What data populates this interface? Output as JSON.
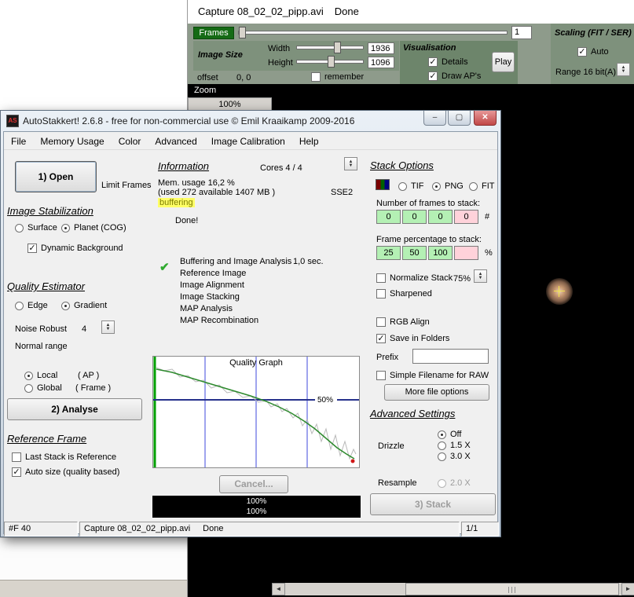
{
  "colors": {
    "frames_badge": "#156b15",
    "highlight_yellow": "#ffff66",
    "box_green": "#b4f0b4",
    "box_pink": "#ffd2da",
    "check_green": "#2faa2f",
    "close_button_red": "#c04848"
  },
  "capture": {
    "title": "Capture 08_02_02_pipp.avi",
    "title_status": "Done",
    "frames": {
      "label": "Frames",
      "value": "1"
    },
    "image_size": {
      "label": "Image Size",
      "width_label": "Width",
      "height_label": "Height",
      "width": "1936",
      "height": "1096"
    },
    "offset": {
      "label": "offset",
      "value": "0, 0",
      "remember": "remember"
    },
    "visualisation": {
      "label": "Visualisation",
      "details": "Details",
      "draw_aps": "Draw AP's",
      "play": "Play"
    },
    "scaling": {
      "label": "Scaling (FIT / SER)",
      "auto": "Auto",
      "range": "Range 16 bit(A)"
    },
    "zoom": {
      "label": "Zoom",
      "value": "100%"
    }
  },
  "stakkert": {
    "title": "AutoStakkert! 2.6.8 - free for non-commercial use © Emil Kraaikamp 2009-2016",
    "window_buttons": {
      "minimize": "–",
      "maximize": "▢",
      "close": "✕"
    },
    "menu": [
      "File",
      "Memory Usage",
      "Color",
      "Advanced",
      "Image Calibration",
      "Help"
    ],
    "left": {
      "open": "1) Open",
      "limit_frames": "Limit Frames",
      "image_stabilization": "Image Stabilization",
      "surface": "Surface",
      "planet": "Planet (COG)",
      "dynamic_background": "Dynamic Background",
      "quality_estimator": "Quality Estimator",
      "edge": "Edge",
      "gradient": "Gradient",
      "noise_robust": "Noise Robust",
      "noise_value": "4",
      "normal_range": "Normal range",
      "local": "Local",
      "local_suffix": "( AP )",
      "global": "Global",
      "global_suffix": "( Frame )",
      "analyse": "2) Analyse",
      "reference_frame": "Reference Frame",
      "last_stack": "Last Stack is Reference",
      "auto_size": "Auto size (quality based)"
    },
    "info": {
      "header": "Information",
      "cores": "Cores 4 / 4",
      "mem1": "Mem. usage 16,2 %",
      "mem2": "(used 272 available 1407 MB )",
      "sse": "SSE2",
      "buffering": "buffering",
      "done": "Done!",
      "check": "✔",
      "tasks": [
        "Buffering and Image Analysis",
        "Reference Image",
        "Image Alignment",
        "Image Stacking",
        "MAP Analysis",
        "MAP Recombination"
      ],
      "task_time": "1,0 sec.",
      "cancel": "Cancel...",
      "progress1": "100%",
      "progress2": "100%"
    },
    "graph": {
      "title": "Quality Graph",
      "fifty": "50%",
      "gray": [
        [
          4,
          14
        ],
        [
          14,
          18
        ],
        [
          24,
          16
        ],
        [
          34,
          26
        ],
        [
          44,
          24
        ],
        [
          54,
          32
        ],
        [
          64,
          30
        ],
        [
          74,
          40
        ],
        [
          84,
          36
        ],
        [
          94,
          46
        ],
        [
          104,
          44
        ],
        [
          114,
          52
        ],
        [
          124,
          50
        ],
        [
          134,
          58
        ],
        [
          144,
          56
        ],
        [
          150,
          64
        ],
        [
          158,
          60
        ],
        [
          164,
          70
        ],
        [
          170,
          66
        ],
        [
          178,
          78
        ],
        [
          184,
          72
        ],
        [
          190,
          88
        ],
        [
          196,
          80
        ],
        [
          202,
          98
        ],
        [
          208,
          86
        ],
        [
          214,
          108
        ],
        [
          220,
          92
        ],
        [
          226,
          118
        ],
        [
          232,
          100
        ],
        [
          238,
          126
        ],
        [
          244,
          108
        ],
        [
          250,
          130
        ],
        [
          255,
          118
        ],
        [
          258,
          124
        ]
      ],
      "green": [
        [
          4,
          16
        ],
        [
          24,
          20
        ],
        [
          44,
          26
        ],
        [
          64,
          32
        ],
        [
          84,
          38
        ],
        [
          104,
          44
        ],
        [
          124,
          50
        ],
        [
          144,
          57
        ],
        [
          160,
          64
        ],
        [
          176,
          72
        ],
        [
          192,
          82
        ],
        [
          206,
          92
        ],
        [
          220,
          104
        ],
        [
          234,
          116
        ],
        [
          246,
          124
        ],
        [
          256,
          130
        ]
      ]
    },
    "stack_options": {
      "header": "Stack Options",
      "tif": "TIF",
      "png": "PNG",
      "fit": "FIT",
      "frames_label": "Number of frames to stack:",
      "frames_values": [
        "0",
        "0",
        "0",
        "0"
      ],
      "hash": "#",
      "pct_label": "Frame percentage to stack:",
      "pct_values": [
        "25",
        "50",
        "100",
        ""
      ],
      "percent": "%",
      "normalize": "Normalize Stack",
      "normalize_pct": "75%",
      "sharpened": "Sharpened",
      "rgb_align": "RGB Align",
      "save_folders": "Save in Folders",
      "prefix": "Prefix",
      "prefix_value": "",
      "simple_filename": "Simple Filename for RAW",
      "more_options": "More file options",
      "advanced": "Advanced Settings",
      "drizzle": "Drizzle",
      "off": "Off",
      "x15": "1.5 X",
      "x30": "3.0 X",
      "resample": "Resample",
      "x20": "2.0 X",
      "stack": "3) Stack"
    },
    "status": {
      "frames": "#F 40",
      "file": "Capture 08_02_02_pipp.avi",
      "file_status": "Done",
      "pages": "1/1"
    }
  }
}
